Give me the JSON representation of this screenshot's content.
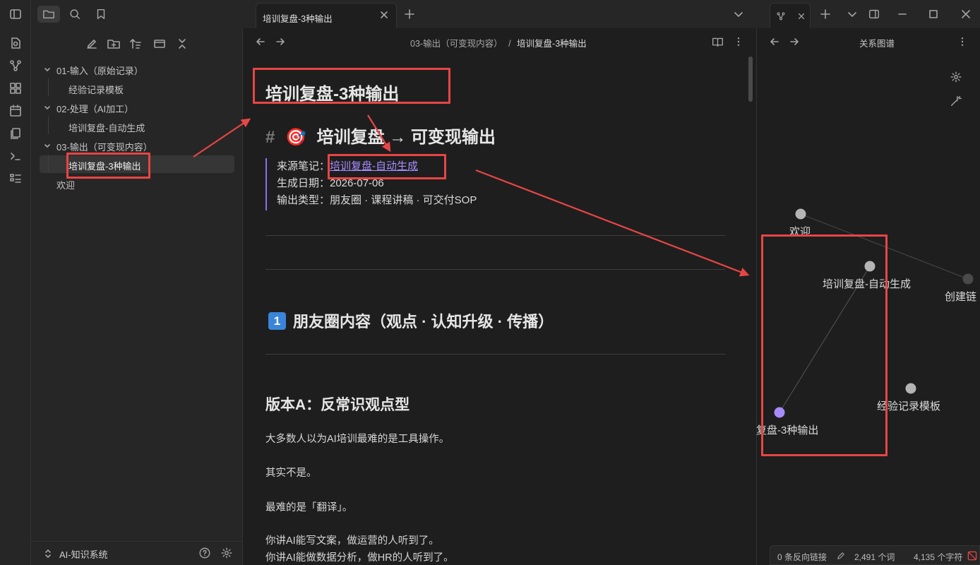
{
  "window": {
    "tab_title": "培训复盘-3种输出"
  },
  "sidebar": {
    "vault_name": "AI-知识系统",
    "tree": [
      {
        "label": "01-输入（原始记录）",
        "children": [
          "经验记录模板"
        ]
      },
      {
        "label": "02-处理（AI加工）",
        "children": [
          "培训复盘-自动生成"
        ]
      },
      {
        "label": "03-输出（可变现内容）",
        "children": [
          "培训复盘-3种输出"
        ]
      },
      {
        "label": "欢迎"
      }
    ]
  },
  "editor": {
    "breadcrumb_folder": "03-输出（可变现内容）",
    "breadcrumb_sep": "/",
    "breadcrumb_file": "培训复盘-3种输出",
    "title": "培训复盘-3种输出",
    "h1_hash": "#",
    "h1_emoji": "🎯",
    "h1_text": "培训复盘 → 可变现输出",
    "source_label": "来源笔记：",
    "source_link": "培训复盘-自动生成",
    "date_line": "生成日期：2026-07-06",
    "type_line": "输出类型：朋友圈 · 课程讲稿 · 可交付SOP",
    "section_badge": "1",
    "section_title": "朋友圈内容（观点 · 认知升级 · 传播）",
    "version_title": "版本A：反常识观点型",
    "paragraphs": [
      "大多数人以为AI培训最难的是工具操作。",
      "其实不是。",
      "最难的是「翻译」。",
      "你讲AI能写文案，做运营的人听到了。",
      "你讲AI能做数据分析，做HR的人听到了。"
    ]
  },
  "graph": {
    "title": "关系图谱",
    "nodes": [
      {
        "label": "欢迎",
        "color": "#b4b4b4"
      },
      {
        "label": "培训复盘-自动生成",
        "color": "#b4b4b4"
      },
      {
        "label": "创建链",
        "color": "#4a4a4a"
      },
      {
        "label": "经验记录模板",
        "color": "#b4b4b4"
      },
      {
        "label": "复盘-3种输出",
        "color": "#a78bfa"
      }
    ]
  },
  "status": {
    "backlinks": "0 条反向链接",
    "words": "2,491 个词",
    "chars": "4,135 个字符"
  },
  "colors": {
    "accent": "#8f6ff0",
    "link": "#a88cff",
    "annotation": "#e84545"
  }
}
